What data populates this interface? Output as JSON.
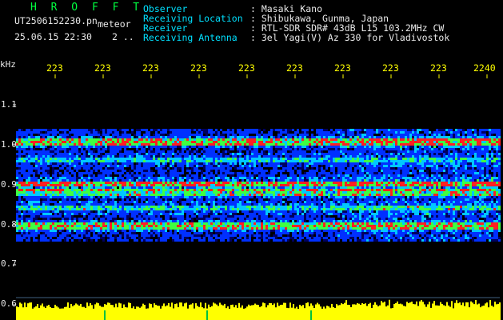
{
  "header": {
    "app_title": "H R O F F T",
    "filename": "UT2506152230.pn",
    "mode_label": "meteor",
    "datetime": "25.06.15 22:30",
    "index": "2 ..",
    "fields": [
      {
        "label": "Observer",
        "value": ": Masaki Kano"
      },
      {
        "label": "Receiving Location",
        "value": ": Shibukawa, Gunma, Japan"
      },
      {
        "label": "Receiver",
        "value": ": RTL-SDR SDR# 43dB L15 103.2MHz CW"
      },
      {
        "label": "Receiving Antenna",
        "value": ": 3el Yagi(V) Az 330 for Vladivostok"
      }
    ]
  },
  "axes": {
    "unit_label": "kHz",
    "time_ticks": [
      "223",
      "223",
      "223",
      "223",
      "223",
      "223",
      "223",
      "223",
      "223",
      "2240"
    ],
    "freq_ticks": [
      "1.1",
      "1.0",
      "0.9",
      "0.8",
      "0.7",
      "0.6"
    ],
    "freq_values": [
      1.1,
      1.0,
      0.9,
      0.8,
      0.7,
      0.6
    ]
  },
  "colors": {
    "background": "#000000",
    "header_label": "#00e0ff",
    "header_value": "#e8e8e8",
    "title": "#00ff40",
    "time_ticks": "#ffff00",
    "signal_bar": "#ffff00",
    "noise_dark": "#000060",
    "noise_blue": "#0030ff",
    "noise_cyan": "#00c8ff",
    "noise_green": "#40ff40",
    "echo_red": "#ff2020"
  }
}
